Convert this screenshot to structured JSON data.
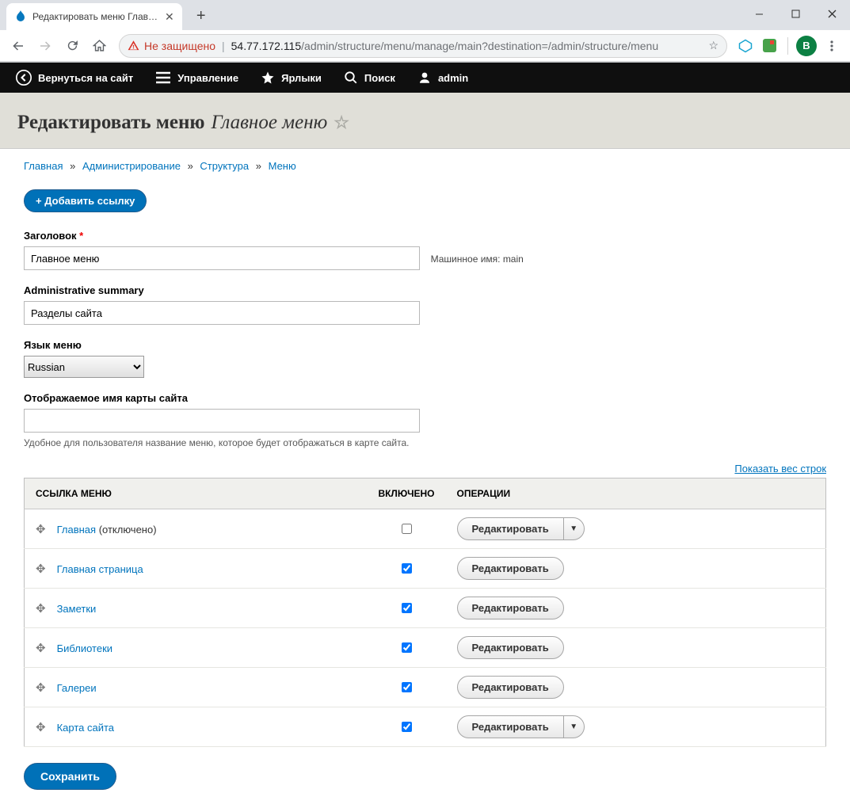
{
  "window": {
    "tab_title": "Редактировать меню Главное м",
    "avatar_letter": "В"
  },
  "address": {
    "warning": "Не защищено",
    "host": "54.77.172.115",
    "path": "/admin/structure/menu/manage/main?destination=/admin/structure/menu"
  },
  "admin_toolbar": {
    "back": "Вернуться на сайт",
    "manage": "Управление",
    "shortcuts": "Ярлыки",
    "search": "Поиск",
    "user": "admin"
  },
  "page": {
    "title_prefix": "Редактировать меню",
    "title_emph": "Главное меню"
  },
  "breadcrumbs": [
    "Главная",
    "Администрирование",
    "Структура",
    "Меню"
  ],
  "actions": {
    "add_link": "+ Добавить ссылку",
    "save": "Сохранить"
  },
  "form": {
    "title_label": "Заголовок",
    "title_value": "Главное меню",
    "machine_name_label": "Машинное имя: main",
    "summary_label": "Administrative summary",
    "summary_value": "Разделы сайта",
    "lang_label": "Язык меню",
    "lang_value": "Russian",
    "sitemap_label": "Отображаемое имя карты сайта",
    "sitemap_value": "",
    "sitemap_desc": "Удобное для пользователя название меню, которое будет отображаться в карте сайта."
  },
  "table": {
    "show_weights": "Показать вес строк",
    "headers": {
      "link": "ССЫЛКА МЕНЮ",
      "enabled": "ВКЛЮЧЕНО",
      "ops": "ОПЕРАЦИИ"
    },
    "edit_label": "Редактировать",
    "rows": [
      {
        "label": "Главная",
        "extra": "(отключено)",
        "enabled": false,
        "dropdown": true
      },
      {
        "label": "Главная страница",
        "extra": "",
        "enabled": true,
        "dropdown": false
      },
      {
        "label": "Заметки",
        "extra": "",
        "enabled": true,
        "dropdown": false
      },
      {
        "label": "Библиотеки",
        "extra": "",
        "enabled": true,
        "dropdown": false
      },
      {
        "label": "Галереи",
        "extra": "",
        "enabled": true,
        "dropdown": false
      },
      {
        "label": "Карта сайта",
        "extra": "",
        "enabled": true,
        "dropdown": true
      }
    ]
  }
}
